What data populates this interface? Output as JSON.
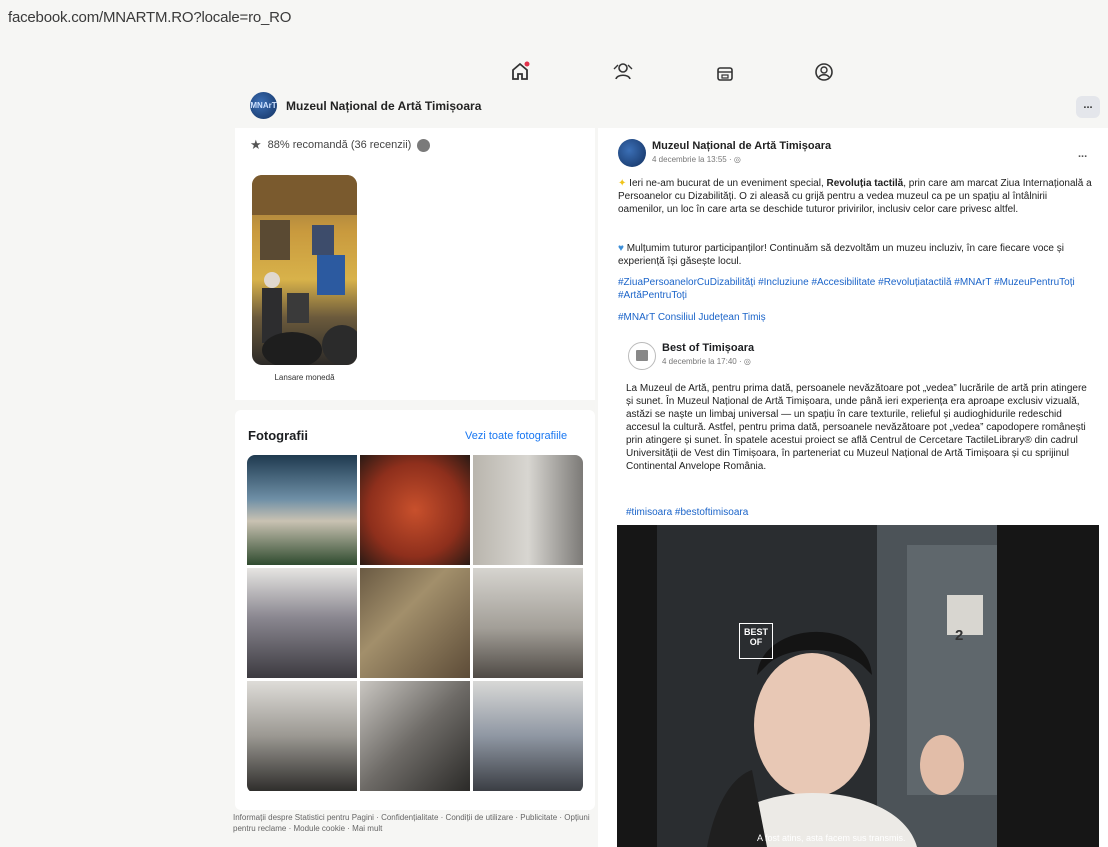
{
  "browser": {
    "url": "facebook.com/MNARTM.RO?locale=ro_RO"
  },
  "nav": {
    "icons": [
      "home-icon",
      "friends-icon",
      "marketplace-icon",
      "profile-icon"
    ]
  },
  "more_button": "...",
  "page": {
    "name": "Muzeul Național de Artă Timișoara",
    "logo_text": "MNArT",
    "rating": "88% recomandă (36 recenzii)"
  },
  "album": {
    "caption": "Lansare monedă"
  },
  "photos": {
    "title": "Fotografii",
    "see_all": "Vezi toate fotografiile",
    "tiles": [
      "#3a5f7d",
      "#b5462a",
      "#9a9a92",
      "#6d6a74",
      "#8c7d62",
      "#a9a49b",
      "#b6b3ad",
      "#8f8c86",
      "#a3a7ab"
    ]
  },
  "footer": "Informații despre Statistici pentru Pagini · Confidențialitate · Condiții de utilizare · Publicitate · Opțiuni pentru reclame · Module cookie · Mai mult",
  "post": {
    "author": "Muzeul Național de Artă Timișoara",
    "date": "4 decembrie la 13:55 · ",
    "more": "...",
    "para1_a": "Ieri ne-am bucurat de un eveniment special, ",
    "para1_b": "Revoluția tactilă",
    "para1_c": ", prin care am marcat Ziua Internațională a Persoanelor cu Dizabilități. O zi aleasă cu grijă pentru a vedea muzeul ca pe un spațiu al întâlnirii oamenilor, un loc în care arta se deschide tuturor privirilor, inclusiv celor care privesc altfel.",
    "para2": "Mulțumim tuturor participanților! Continuăm să dezvoltăm un muzeu incluziv, în care fiecare voce și experiență își găsește locul.",
    "tags1": "#ZiuaPersoanelorCuDizabilități #Incluziune #Accesibilitate #Revoluțiatactilă #MNArT #MuzeuPentruToți #ArtăPentruToți",
    "tags2": "#MNArT Consiliul Județean Timiș",
    "shared": {
      "author": "Best of Timișoara",
      "date": "4 decembrie la 17:40 · ",
      "body": "La Muzeul de Artă, pentru prima dată, persoanele nevăzătoare pot „vedea” lucrările de artă prin atingere și sunet. În Muzeul Național de Artă Timișoara, unde până ieri experiența era aproape exclusiv vizuală, astăzi se naște un limbaj universal — un spațiu în care texturile, relieful și audioghidurile redeschid accesul la cultură. Astfel, pentru prima dată, persoanele nevăzătoare pot „vedea” capodopere românești prin atingere și sunet. În spatele acestui proiect se află Centrul de Cercetare TactileLibrary® din cadrul Universității de Vest din Timișoara, în parteneriat cu Muzeul Național de Artă Timișoara și cu sprijinul Continental Anvelope România.",
      "tags": "#timisoara #bestoftimisoara",
      "video_badge": "BEST OF",
      "sign_number": "2",
      "subtitle": "A fost atins, asta facem sus transmis."
    }
  }
}
